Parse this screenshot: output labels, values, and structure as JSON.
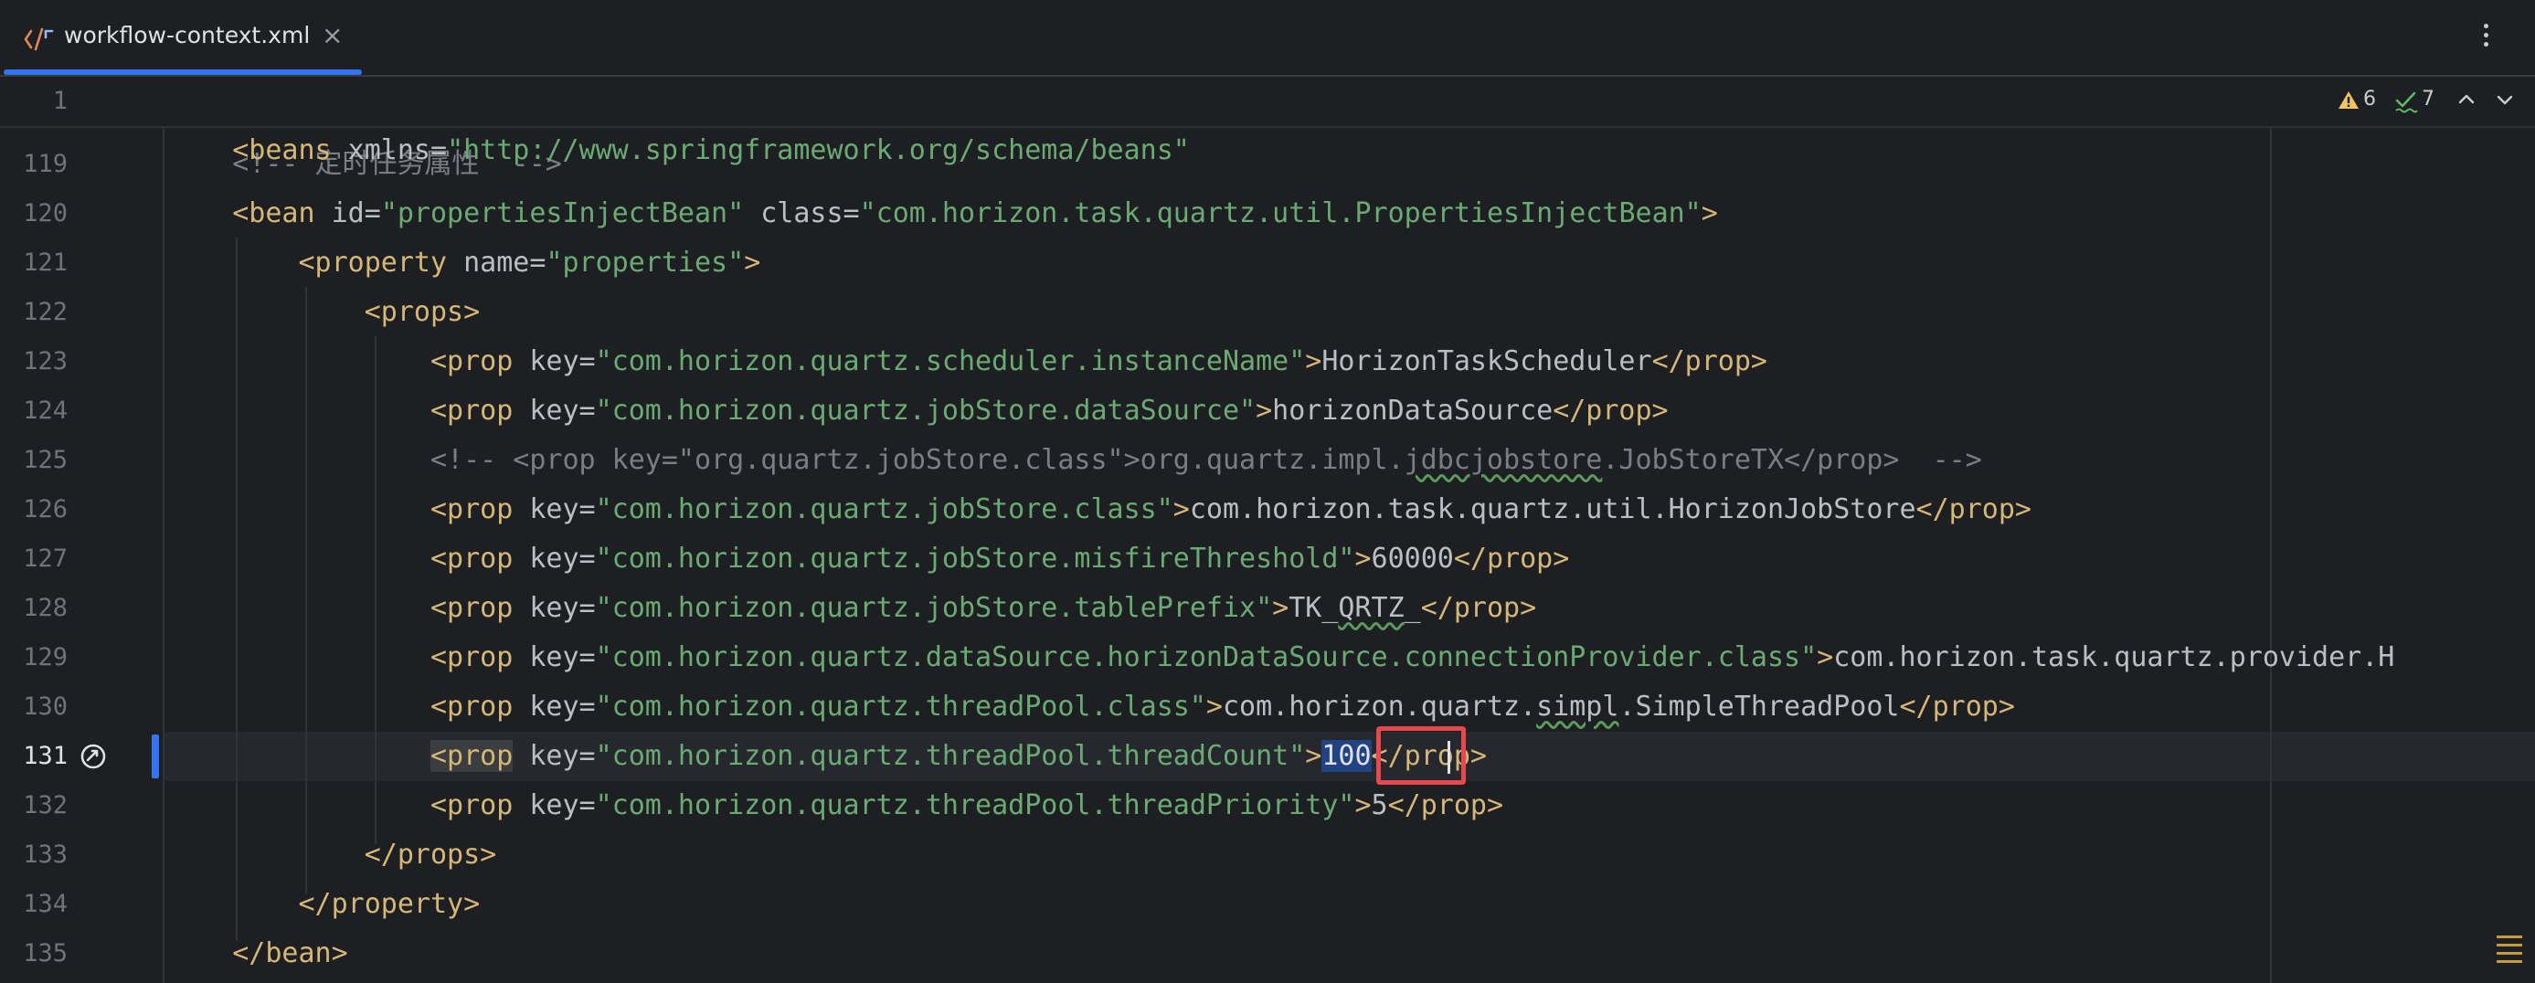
{
  "tab": {
    "filename": "workflow-context.xml",
    "close_glyph": "×"
  },
  "inspections": {
    "warnings": "6",
    "typos": "7"
  },
  "sticky_line": {
    "number": "1",
    "tag_open": "<beans",
    "attr": " xmlns",
    "eq": "=",
    "value": "\"http://www.springframework.org/schema/beans\"",
    "tag_close": ""
  },
  "lines": [
    {
      "n": "119",
      "indent": "    ",
      "parts": [
        {
          "c": "cmt",
          "t": "<!-- 定时任务属性  -->"
        }
      ]
    },
    {
      "n": "120",
      "indent": "    ",
      "parts": [
        {
          "c": "tag",
          "t": "<bean"
        },
        {
          "c": "attr",
          "t": " id"
        },
        {
          "c": "txt",
          "t": "="
        },
        {
          "c": "val",
          "t": "\"propertiesInjectBean\""
        },
        {
          "c": "attr",
          "t": " class"
        },
        {
          "c": "txt",
          "t": "="
        },
        {
          "c": "val",
          "t": "\"com.horizon.task.quartz.util.PropertiesInjectBean\""
        },
        {
          "c": "tag",
          "t": ">"
        }
      ]
    },
    {
      "n": "121",
      "indent": "        ",
      "parts": [
        {
          "c": "tag",
          "t": "<property"
        },
        {
          "c": "attr",
          "t": " name"
        },
        {
          "c": "txt",
          "t": "="
        },
        {
          "c": "val",
          "t": "\"properties\""
        },
        {
          "c": "tag",
          "t": ">"
        }
      ]
    },
    {
      "n": "122",
      "indent": "            ",
      "parts": [
        {
          "c": "tag",
          "t": "<props>"
        }
      ]
    },
    {
      "n": "123",
      "indent": "                ",
      "parts": [
        {
          "c": "tag",
          "t": "<prop"
        },
        {
          "c": "attr",
          "t": " key"
        },
        {
          "c": "txt",
          "t": "="
        },
        {
          "c": "val",
          "t": "\"com.horizon.quartz.scheduler.instanceName\""
        },
        {
          "c": "tag",
          "t": ">"
        },
        {
          "c": "txt",
          "t": "HorizonTaskScheduler"
        },
        {
          "c": "tag",
          "t": "</prop>"
        }
      ]
    },
    {
      "n": "124",
      "indent": "                ",
      "parts": [
        {
          "c": "tag",
          "t": "<prop"
        },
        {
          "c": "attr",
          "t": " key"
        },
        {
          "c": "txt",
          "t": "="
        },
        {
          "c": "val",
          "t": "\"com.horizon.quartz.jobStore.dataSource\""
        },
        {
          "c": "tag",
          "t": ">"
        },
        {
          "c": "txt",
          "t": "horizonDataSource"
        },
        {
          "c": "tag",
          "t": "</prop>"
        }
      ]
    },
    {
      "n": "125",
      "indent": "                ",
      "parts": [
        {
          "c": "cmt",
          "t": "<!-- <prop key=\"org.quartz.jobStore.class\">org.quartz.impl."
        },
        {
          "c": "cmt wavy",
          "t": "jdbcjobstore"
        },
        {
          "c": "cmt",
          "t": ".JobStoreTX</prop>  -->"
        }
      ]
    },
    {
      "n": "126",
      "indent": "                ",
      "parts": [
        {
          "c": "tag",
          "t": "<prop"
        },
        {
          "c": "attr",
          "t": " key"
        },
        {
          "c": "txt",
          "t": "="
        },
        {
          "c": "val",
          "t": "\"com.horizon.quartz.jobStore.class\""
        },
        {
          "c": "tag",
          "t": ">"
        },
        {
          "c": "txt",
          "t": "com.horizon.task.quartz.util.HorizonJobStore"
        },
        {
          "c": "tag",
          "t": "</prop>"
        }
      ]
    },
    {
      "n": "127",
      "indent": "                ",
      "parts": [
        {
          "c": "tag",
          "t": "<prop"
        },
        {
          "c": "attr",
          "t": " key"
        },
        {
          "c": "txt",
          "t": "="
        },
        {
          "c": "val",
          "t": "\"com.horizon.quartz.jobStore.misfireThreshold\""
        },
        {
          "c": "tag",
          "t": ">"
        },
        {
          "c": "txt",
          "t": "60000"
        },
        {
          "c": "tag",
          "t": "</prop>"
        }
      ]
    },
    {
      "n": "128",
      "indent": "                ",
      "parts": [
        {
          "c": "tag",
          "t": "<prop"
        },
        {
          "c": "attr",
          "t": " key"
        },
        {
          "c": "txt",
          "t": "="
        },
        {
          "c": "val",
          "t": "\"com.horizon.quartz.jobStore.tablePrefix\""
        },
        {
          "c": "tag",
          "t": ">"
        },
        {
          "c": "txt",
          "t": "TK_"
        },
        {
          "c": "txt wavy",
          "t": "QRTZ"
        },
        {
          "c": "txt",
          "t": "_"
        },
        {
          "c": "tag",
          "t": "</prop>"
        }
      ]
    },
    {
      "n": "129",
      "indent": "                ",
      "parts": [
        {
          "c": "tag",
          "t": "<prop"
        },
        {
          "c": "attr",
          "t": " key"
        },
        {
          "c": "txt",
          "t": "="
        },
        {
          "c": "val",
          "t": "\"com.horizon.quartz.dataSource.horizonDataSource.connectionProvider.class\""
        },
        {
          "c": "tag",
          "t": ">"
        },
        {
          "c": "txt",
          "t": "com.horizon.task.quartz.provider.H"
        }
      ]
    },
    {
      "n": "130",
      "indent": "                ",
      "parts": [
        {
          "c": "tag",
          "t": "<prop"
        },
        {
          "c": "attr",
          "t": " key"
        },
        {
          "c": "txt",
          "t": "="
        },
        {
          "c": "val",
          "t": "\"com.horizon.quartz.threadPool.class\""
        },
        {
          "c": "tag",
          "t": ">"
        },
        {
          "c": "txt",
          "t": "com.horizon.quartz."
        },
        {
          "c": "txt wavy",
          "t": "simpl"
        },
        {
          "c": "txt",
          "t": ".SimpleThreadPool"
        },
        {
          "c": "tag",
          "t": "</prop>"
        }
      ]
    },
    {
      "n": "131",
      "indent": "                ",
      "current": true,
      "parts": [
        {
          "c": "tag tag-hl",
          "t": "<prop"
        },
        {
          "c": "attr",
          "t": " key"
        },
        {
          "c": "txt",
          "t": "="
        },
        {
          "c": "val",
          "t": "\"com.horizon.quartz.threadPool.threadCount\""
        },
        {
          "c": "tag",
          "t": ">"
        },
        {
          "c": "txt sel",
          "t": "100"
        },
        {
          "c": "tag",
          "t": "</prop>"
        }
      ]
    },
    {
      "n": "132",
      "indent": "                ",
      "parts": [
        {
          "c": "tag",
          "t": "<prop"
        },
        {
          "c": "attr",
          "t": " key"
        },
        {
          "c": "txt",
          "t": "="
        },
        {
          "c": "val",
          "t": "\"com.horizon.quartz.threadPool.threadPriority\""
        },
        {
          "c": "tag",
          "t": ">"
        },
        {
          "c": "txt",
          "t": "5"
        },
        {
          "c": "tag",
          "t": "</prop>"
        }
      ]
    },
    {
      "n": "133",
      "indent": "            ",
      "parts": [
        {
          "c": "tag",
          "t": "</props>"
        }
      ]
    },
    {
      "n": "134",
      "indent": "        ",
      "parts": [
        {
          "c": "tag",
          "t": "</property>"
        }
      ]
    },
    {
      "n": "135",
      "indent": "    ",
      "parts": [
        {
          "c": "tag",
          "t": "</bean>"
        }
      ]
    }
  ],
  "colors": {
    "accent": "#3574f0",
    "tag": "#d5b778",
    "value": "#6aab73",
    "comment": "#7a7e85",
    "highlight_box": "#e5484d"
  }
}
